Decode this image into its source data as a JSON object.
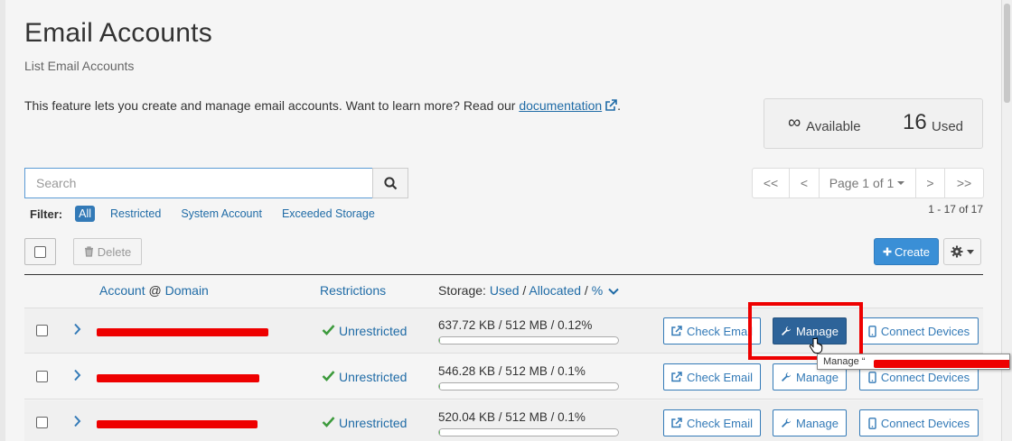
{
  "header": {
    "title": "Email Accounts",
    "subtitle": "List Email Accounts"
  },
  "intro": {
    "text": "This feature lets you create and manage email accounts. Want to learn more? Read our ",
    "link": "documentation",
    "end": "."
  },
  "stats": {
    "available_symbol": "∞",
    "available_label": "Available",
    "used_count": "16",
    "used_label": "Used"
  },
  "search": {
    "placeholder": "Search"
  },
  "pager": {
    "first": "<<",
    "prev": "<",
    "page_label": "Page 1 of 1",
    "next": ">",
    "last": ">>"
  },
  "count": "1 - 17 of 17",
  "filter": {
    "label": "Filter:",
    "options": [
      "All",
      "Restricted",
      "System Account",
      "Exceeded Storage"
    ],
    "active": "All"
  },
  "toolbar": {
    "delete_label": "Delete",
    "create_label": "Create"
  },
  "table": {
    "col_account": "Account",
    "col_at": "@",
    "col_domain": "Domain",
    "col_restrictions": "Restrictions",
    "col_storage_prefix": "Storage:",
    "col_used": "Used",
    "col_sep": "/",
    "col_allocated": "Allocated",
    "col_pct": "%",
    "rows": [
      {
        "restriction": "Unrestricted",
        "storage": "637.72 KB / 512 MB / 0.12%",
        "usage_pct": 0.12
      },
      {
        "restriction": "Unrestricted",
        "storage": "546.28 KB / 512 MB / 0.1%",
        "usage_pct": 0.1
      },
      {
        "restriction": "Unrestricted",
        "storage": "520.04 KB / 512 MB / 0.1%",
        "usage_pct": 0.1
      }
    ],
    "actions": {
      "check_email": "Check Email",
      "manage": "Manage",
      "connect_devices": "Connect Devices"
    }
  },
  "tooltip": {
    "prefix": "Manage “"
  },
  "colors": {
    "primary": "#337ab7",
    "link": "#1f6ba6",
    "create": "#3a8fd6",
    "highlight": "#ee0000",
    "success": "#5cb85c"
  }
}
